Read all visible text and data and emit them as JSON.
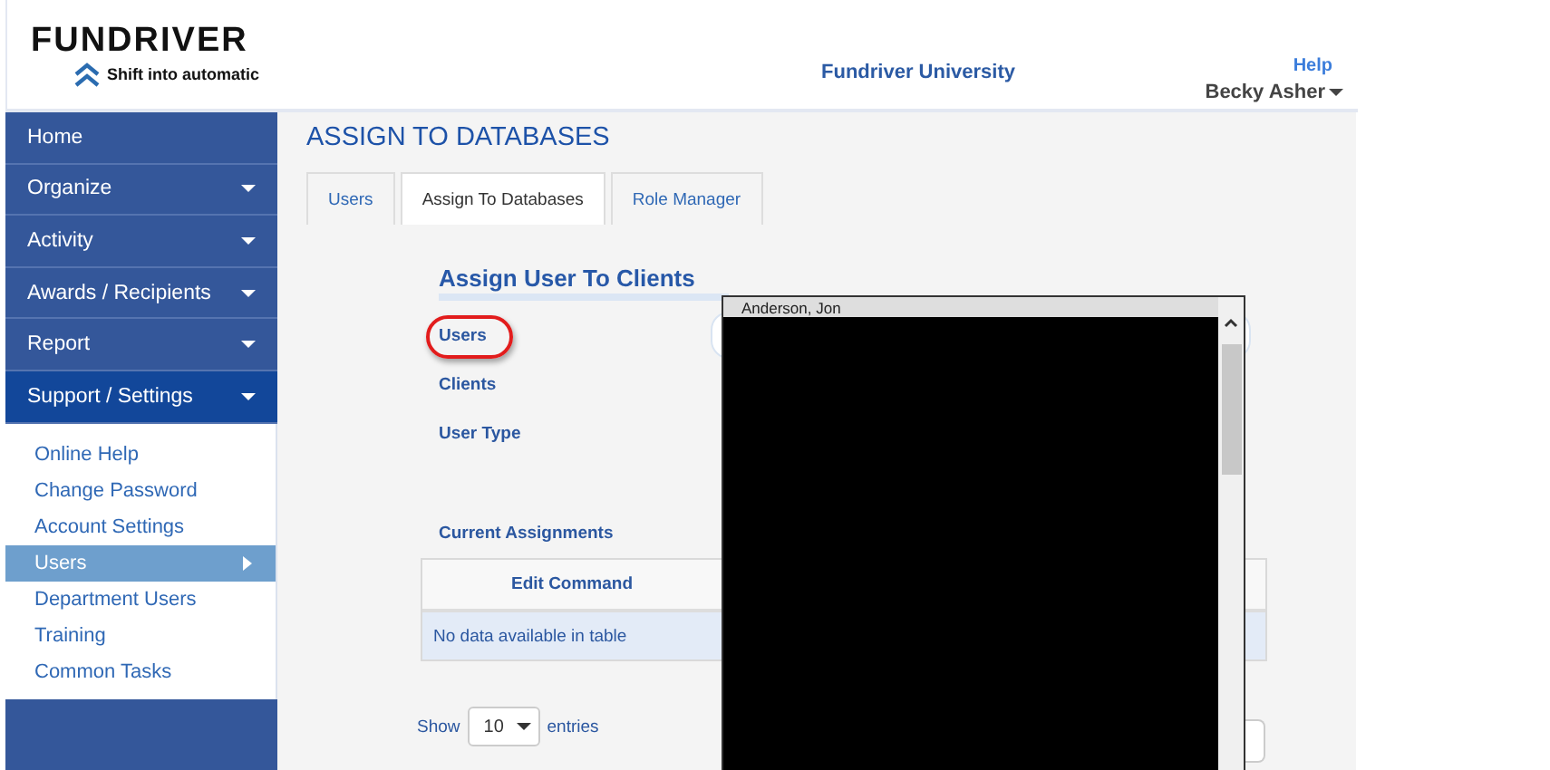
{
  "logo": {
    "name": "FUNDRIVER",
    "tagline": "Shift into automatic"
  },
  "header": {
    "organization": "Fundriver University",
    "help": "Help",
    "user": "Becky Asher"
  },
  "sidebar": {
    "items": [
      {
        "label": "Home",
        "has_menu": false,
        "expanded": false
      },
      {
        "label": "Organize",
        "has_menu": true,
        "expanded": false
      },
      {
        "label": "Activity",
        "has_menu": true,
        "expanded": false
      },
      {
        "label": "Awards / Recipients",
        "has_menu": true,
        "expanded": false
      },
      {
        "label": "Report",
        "has_menu": true,
        "expanded": false
      },
      {
        "label": "Support / Settings",
        "has_menu": true,
        "expanded": true,
        "children": [
          {
            "label": "Online Help",
            "selected": false
          },
          {
            "label": "Change Password",
            "selected": false
          },
          {
            "label": "Account Settings",
            "selected": false
          },
          {
            "label": "Users",
            "selected": true
          },
          {
            "label": "Department Users",
            "selected": false
          },
          {
            "label": "Training",
            "selected": false
          },
          {
            "label": "Common Tasks",
            "selected": false
          }
        ]
      }
    ]
  },
  "page_title": "ASSIGN TO DATABASES",
  "tabs": [
    {
      "label": "Users",
      "selected": false
    },
    {
      "label": "Assign To Databases",
      "selected": true
    },
    {
      "label": "Role Manager",
      "selected": false
    }
  ],
  "form": {
    "heading": "Assign User To Clients",
    "fields": [
      {
        "label": "Users",
        "highlighted": true
      },
      {
        "label": "Clients",
        "highlighted": false
      },
      {
        "label": "User Type",
        "highlighted": false
      }
    ]
  },
  "assignments": {
    "label": "Current Assignments",
    "columns": [
      "Edit Command"
    ],
    "empty_message": "No data available in table",
    "show_label": "Show",
    "page_size": "10",
    "entries_label": "entries"
  },
  "dropdown": {
    "options": [
      "Anderson, Jon"
    ]
  }
}
